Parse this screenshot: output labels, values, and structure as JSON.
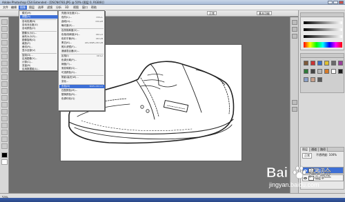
{
  "titlebar": {
    "title": "Adobe Photoshop CS4 Extended - [DSCN4783.JPG @ 50% (图层 0, RGB/8)]"
  },
  "menubar": {
    "items": [
      {
        "label": "文件"
      },
      {
        "label": "编辑"
      },
      {
        "label": "图像"
      },
      {
        "label": "图层"
      },
      {
        "label": "选择"
      },
      {
        "label": "滤镜"
      },
      {
        "label": "分析"
      },
      {
        "label": "3D"
      },
      {
        "label": "视图"
      },
      {
        "label": "窗口"
      },
      {
        "label": "帮助"
      }
    ],
    "active_index": 2
  },
  "optionsbar": {
    "preset": "基本功能",
    "mode": "正常",
    "select": "选择"
  },
  "image_menu": {
    "items": [
      {
        "label": "模式(M)",
        "shortcut": ""
      },
      {
        "label": "调整(A)",
        "shortcut": ""
      },
      {
        "label": "自动色调(N)",
        "shortcut": "Shift+Ctrl+L"
      },
      {
        "label": "自动对比度(U)",
        "shortcut": "Alt+Shift+Ctrl+L"
      },
      {
        "label": "自动颜色(O)",
        "shortcut": "Shift+Ctrl+B"
      },
      {
        "label": "图像大小(I)...",
        "shortcut": "Alt+Ctrl+I"
      },
      {
        "label": "画布大小(S)...",
        "shortcut": "Alt+Ctrl+C"
      },
      {
        "label": "图像旋转(G)",
        "shortcut": ""
      },
      {
        "label": "裁剪(P)",
        "shortcut": ""
      },
      {
        "label": "裁切(R)...",
        "shortcut": ""
      },
      {
        "label": "显示全部(V)",
        "shortcut": ""
      },
      {
        "label": "复制(D)...",
        "shortcut": ""
      },
      {
        "label": "应用图像(Y)...",
        "shortcut": ""
      },
      {
        "label": "计算(C)...",
        "shortcut": ""
      },
      {
        "label": "变量(B)",
        "shortcut": ""
      },
      {
        "label": "应用数据组(L)...",
        "shortcut": ""
      },
      {
        "label": "陷印(T)...",
        "shortcut": ""
      }
    ]
  },
  "adjust_submenu": {
    "items": [
      {
        "label": "亮度/对比度(C)...",
        "shortcut": ""
      },
      {
        "label": "色阶(L)...",
        "shortcut": "Ctrl+L"
      },
      {
        "label": "曲线(U)...",
        "shortcut": "Ctrl+M"
      },
      {
        "label": "曝光度(E)...",
        "shortcut": ""
      },
      {
        "label": "自然饱和度(V)...",
        "shortcut": ""
      },
      {
        "label": "色相/饱和度(H)...",
        "shortcut": "Ctrl+U"
      },
      {
        "label": "色彩平衡(B)...",
        "shortcut": "Ctrl+B"
      },
      {
        "label": "黑白(K)...",
        "shortcut": "Alt+Shift+Ctrl+B"
      },
      {
        "label": "照片滤镜(F)...",
        "shortcut": ""
      },
      {
        "label": "通道混合器(X)...",
        "shortcut": ""
      },
      {
        "label": "反相(I)",
        "shortcut": "Ctrl+I"
      },
      {
        "label": "色调分离(P)...",
        "shortcut": ""
      },
      {
        "label": "阈值(T)...",
        "shortcut": ""
      },
      {
        "label": "渐变映射(G)...",
        "shortcut": ""
      },
      {
        "label": "可选颜色(S)...",
        "shortcut": ""
      },
      {
        "label": "阴影/高光(W)...",
        "shortcut": ""
      },
      {
        "label": "变化...",
        "shortcut": ""
      },
      {
        "label": "去色(D)",
        "shortcut": "Shift+Ctrl+U"
      },
      {
        "label": "匹配颜色(M)...",
        "shortcut": ""
      },
      {
        "label": "替换颜色(R)...",
        "shortcut": ""
      },
      {
        "label": "色调均化(Q)",
        "shortcut": ""
      }
    ],
    "highlight_index": 17
  },
  "layers_panel": {
    "tabs": [
      "图层",
      "通道",
      "路径"
    ],
    "blend_mode": "正常",
    "opacity_label": "不透明度: 100%",
    "layers": [
      {
        "name": "图层 1"
      },
      {
        "name": "图层 0"
      }
    ]
  },
  "status": {
    "zoom": "50%"
  },
  "watermark": {
    "brand": "Bai",
    "brand2": "经验",
    "url": "jingyan.baidu.com"
  },
  "colors": {
    "menu_highlight": "#3d6fd6",
    "canvas": "#ffffff",
    "workspace": "#6e6e6e"
  }
}
